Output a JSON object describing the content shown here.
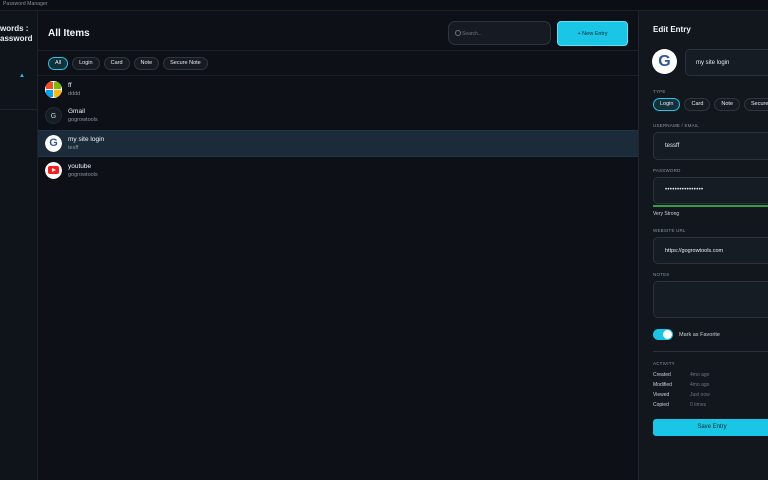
{
  "window": {
    "title": "Password Manager"
  },
  "sidebar": {
    "brand_line1": "words :",
    "brand_line2": "assword",
    "caret": "▲"
  },
  "main": {
    "title": "All Items",
    "search_placeholder": "Search...",
    "new_entry_label": "+ New Entry",
    "filters": [
      {
        "label": "All",
        "active": true
      },
      {
        "label": "Login",
        "active": false
      },
      {
        "label": "Card",
        "active": false
      },
      {
        "label": "Note",
        "active": false
      },
      {
        "label": "Secure Note",
        "active": false
      }
    ],
    "items": [
      {
        "name": "ff",
        "sub": "dddd",
        "icon": "microsoft-icon",
        "selected": false
      },
      {
        "name": "Gmail",
        "sub": "gogrowtools",
        "icon": "g-letter-icon",
        "selected": false
      },
      {
        "name": "my site login",
        "sub": "tesff",
        "icon": "gogrowtools-icon",
        "selected": true
      },
      {
        "name": "youtube",
        "sub": "gogrowtools",
        "icon": "youtube-icon",
        "selected": false
      }
    ]
  },
  "panel": {
    "title": "Edit Entry",
    "entry_name": "my site login",
    "type_label": "TYPE",
    "types": [
      {
        "label": "Login",
        "active": true
      },
      {
        "label": "Card",
        "active": false
      },
      {
        "label": "Note",
        "active": false
      },
      {
        "label": "Secure",
        "active": false
      }
    ],
    "username_label": "USERNAME / EMAIL",
    "username_value": "tessff",
    "password_label": "PASSWORD",
    "password_value": "••••••••••••••••",
    "strength_text": "Very Strong",
    "strength_fraction": 1.0,
    "url_label": "WEBSITE URL",
    "url_value": "https://gogrowtools.com",
    "notes_label": "NOTES",
    "notes_value": "",
    "favorite_label": "Mark as Favorite",
    "favorite_on": true,
    "activity_label": "ACTIVITY",
    "activity": [
      {
        "key": "Created",
        "value": "4mo ago"
      },
      {
        "key": "Modified",
        "value": "4mo ago"
      },
      {
        "key": "Viewed",
        "value": "Just now"
      },
      {
        "key": "Copied",
        "value": "0 times"
      }
    ],
    "save_label": "Save Entry"
  },
  "colors": {
    "accent": "#19c6e6",
    "background": "#0d1117",
    "panel": "#12171e",
    "selected_row": "#1b2b3a"
  }
}
